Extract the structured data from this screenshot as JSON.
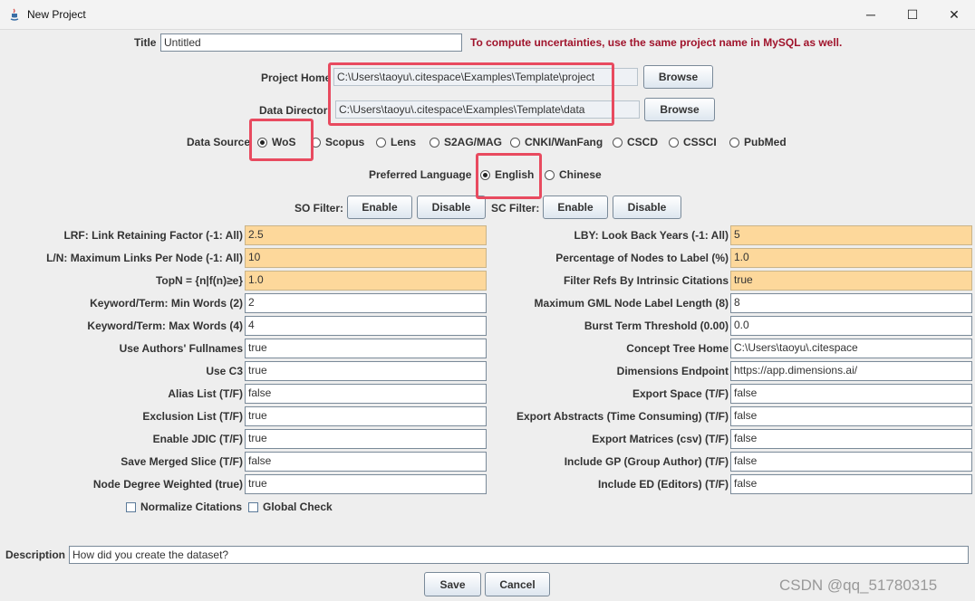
{
  "window": {
    "title": "New Project",
    "minimize": "─",
    "maximize": "☐",
    "close": "✕"
  },
  "title_label": "Title",
  "title_value": "Untitled",
  "warning": "To compute uncertainties, use the same project name in MySQL as well.",
  "project_home": {
    "label": "Project Home",
    "value": "C:\\Users\\taoyu\\.citespace\\Examples\\Template\\project",
    "button": "Browse"
  },
  "data_directory": {
    "label": "Data Director",
    "value": "C:\\Users\\taoyu\\.citespace\\Examples\\Template\\data",
    "button": "Browse"
  },
  "data_source": {
    "label": "Data Source",
    "options": [
      "WoS",
      "Scopus",
      "Lens",
      "S2AG/MAG",
      "CNKI/WanFang",
      "CSCD",
      "CSSCI",
      "PubMed"
    ],
    "selected": "WoS"
  },
  "language": {
    "label": "Preferred Language",
    "options": [
      "English",
      "Chinese"
    ],
    "selected": "English"
  },
  "so_filter": {
    "label": "SO Filter:",
    "enable": "Enable",
    "disable": "Disable"
  },
  "sc_filter": {
    "label": "SC Filter:",
    "enable": "Enable",
    "disable": "Disable"
  },
  "left_params": [
    {
      "label": "LRF: Link Retaining Factor (-1: All)",
      "value": "2.5",
      "highlight": true
    },
    {
      "label": "L/N: Maximum Links Per Node (-1: All)",
      "value": "10",
      "highlight": true
    },
    {
      "label": "TopN = {n|f(n)≥e}",
      "value": "1.0",
      "highlight": true
    },
    {
      "label": "Keyword/Term: Min Words (2)",
      "value": "2",
      "highlight": false
    },
    {
      "label": "Keyword/Term: Max Words (4)",
      "value": "4",
      "highlight": false
    },
    {
      "label": "Use Authors' Fullnames",
      "value": "true",
      "highlight": false
    },
    {
      "label": "Use C3",
      "value": "true",
      "highlight": false
    },
    {
      "label": "Alias List (T/F)",
      "value": "false",
      "highlight": false
    },
    {
      "label": "Exclusion List (T/F)",
      "value": "true",
      "highlight": false
    },
    {
      "label": "Enable JDIC (T/F)",
      "value": "true",
      "highlight": false
    },
    {
      "label": "Save Merged Slice (T/F)",
      "value": "false",
      "highlight": false
    },
    {
      "label": "Node Degree Weighted (true)",
      "value": "true",
      "highlight": false
    }
  ],
  "right_params": [
    {
      "label": "LBY: Look Back Years (-1: All)",
      "value": "5",
      "highlight": true
    },
    {
      "label": "Percentage of Nodes to Label (%)",
      "value": "1.0",
      "highlight": true
    },
    {
      "label": "Filter Refs By Intrinsic Citations",
      "value": "true",
      "highlight": true
    },
    {
      "label": "Maximum GML Node Label Length (8)",
      "value": "8",
      "highlight": false
    },
    {
      "label": "Burst Term Threshold (0.00)",
      "value": "0.0",
      "highlight": false
    },
    {
      "label": "Concept Tree Home",
      "value": "C:\\Users\\taoyu\\.citespace",
      "highlight": false
    },
    {
      "label": "Dimensions Endpoint",
      "value": "https://app.dimensions.ai/",
      "highlight": false
    },
    {
      "label": "Export Space (T/F)",
      "value": "false",
      "highlight": false
    },
    {
      "label": "Export Abstracts (Time Consuming) (T/F)",
      "value": "false",
      "highlight": false
    },
    {
      "label": "Export Matrices (csv) (T/F)",
      "value": "false",
      "highlight": false
    },
    {
      "label": "Include GP (Group Author) (T/F)",
      "value": "false",
      "highlight": false
    },
    {
      "label": "Include ED (Editors) (T/F)",
      "value": "false",
      "highlight": false
    }
  ],
  "checkboxes": [
    {
      "label": "Normalize Citations",
      "checked": false
    },
    {
      "label": "Global Check",
      "checked": false
    }
  ],
  "description": {
    "label": "Description",
    "value": "How did you create the dataset?"
  },
  "save": "Save",
  "cancel": "Cancel",
  "watermark": "CSDN @qq_51780315",
  "colors": {
    "highlight": "#fdd89b",
    "annotation": "#e84a5f",
    "warning": "#a0142c"
  }
}
